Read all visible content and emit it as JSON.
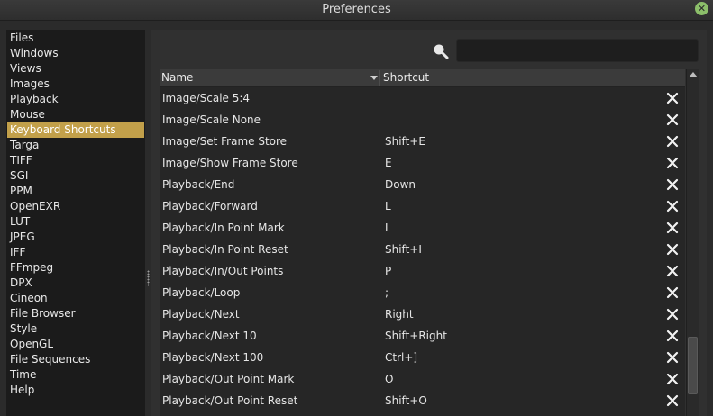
{
  "window": {
    "title": "Preferences",
    "close_glyph": "✕"
  },
  "sidebar": {
    "items": [
      {
        "label": "Files",
        "selected": false
      },
      {
        "label": "Windows",
        "selected": false
      },
      {
        "label": "Views",
        "selected": false
      },
      {
        "label": "Images",
        "selected": false
      },
      {
        "label": "Playback",
        "selected": false
      },
      {
        "label": "Mouse",
        "selected": false
      },
      {
        "label": "Keyboard Shortcuts",
        "selected": true
      },
      {
        "label": "Targa",
        "selected": false
      },
      {
        "label": "TIFF",
        "selected": false
      },
      {
        "label": "SGI",
        "selected": false
      },
      {
        "label": "PPM",
        "selected": false
      },
      {
        "label": "OpenEXR",
        "selected": false
      },
      {
        "label": "LUT",
        "selected": false
      },
      {
        "label": "JPEG",
        "selected": false
      },
      {
        "label": "IFF",
        "selected": false
      },
      {
        "label": "FFmpeg",
        "selected": false
      },
      {
        "label": "DPX",
        "selected": false
      },
      {
        "label": "Cineon",
        "selected": false
      },
      {
        "label": "File Browser",
        "selected": false
      },
      {
        "label": "Style",
        "selected": false
      },
      {
        "label": "OpenGL",
        "selected": false
      },
      {
        "label": "File Sequences",
        "selected": false
      },
      {
        "label": "Time",
        "selected": false
      },
      {
        "label": "Help",
        "selected": false
      }
    ]
  },
  "search": {
    "value": "",
    "icon": "search-icon"
  },
  "table": {
    "columns": {
      "name": "Name",
      "shortcut": "Shortcut"
    },
    "rows": [
      {
        "name": "Image/Scale 5:4",
        "shortcut": ""
      },
      {
        "name": "Image/Scale None",
        "shortcut": ""
      },
      {
        "name": "Image/Set Frame Store",
        "shortcut": "Shift+E"
      },
      {
        "name": "Image/Show Frame Store",
        "shortcut": "E"
      },
      {
        "name": "Playback/End",
        "shortcut": "Down"
      },
      {
        "name": "Playback/Forward",
        "shortcut": "L"
      },
      {
        "name": "Playback/In Point Mark",
        "shortcut": "I"
      },
      {
        "name": "Playback/In Point Reset",
        "shortcut": "Shift+I"
      },
      {
        "name": "Playback/In/Out Points",
        "shortcut": "P"
      },
      {
        "name": "Playback/Loop",
        "shortcut": ";"
      },
      {
        "name": "Playback/Next",
        "shortcut": "Right"
      },
      {
        "name": "Playback/Next 10",
        "shortcut": "Shift+Right"
      },
      {
        "name": "Playback/Next 100",
        "shortcut": "Ctrl+]"
      },
      {
        "name": "Playback/Out Point Mark",
        "shortcut": "O"
      },
      {
        "name": "Playback/Out Point Reset",
        "shortcut": "Shift+O"
      }
    ]
  },
  "colors": {
    "selection": "#c2a04a",
    "sidebar_bg": "#1b1b1b",
    "table_bg": "#262626",
    "close_button": "#8cbf6a"
  }
}
